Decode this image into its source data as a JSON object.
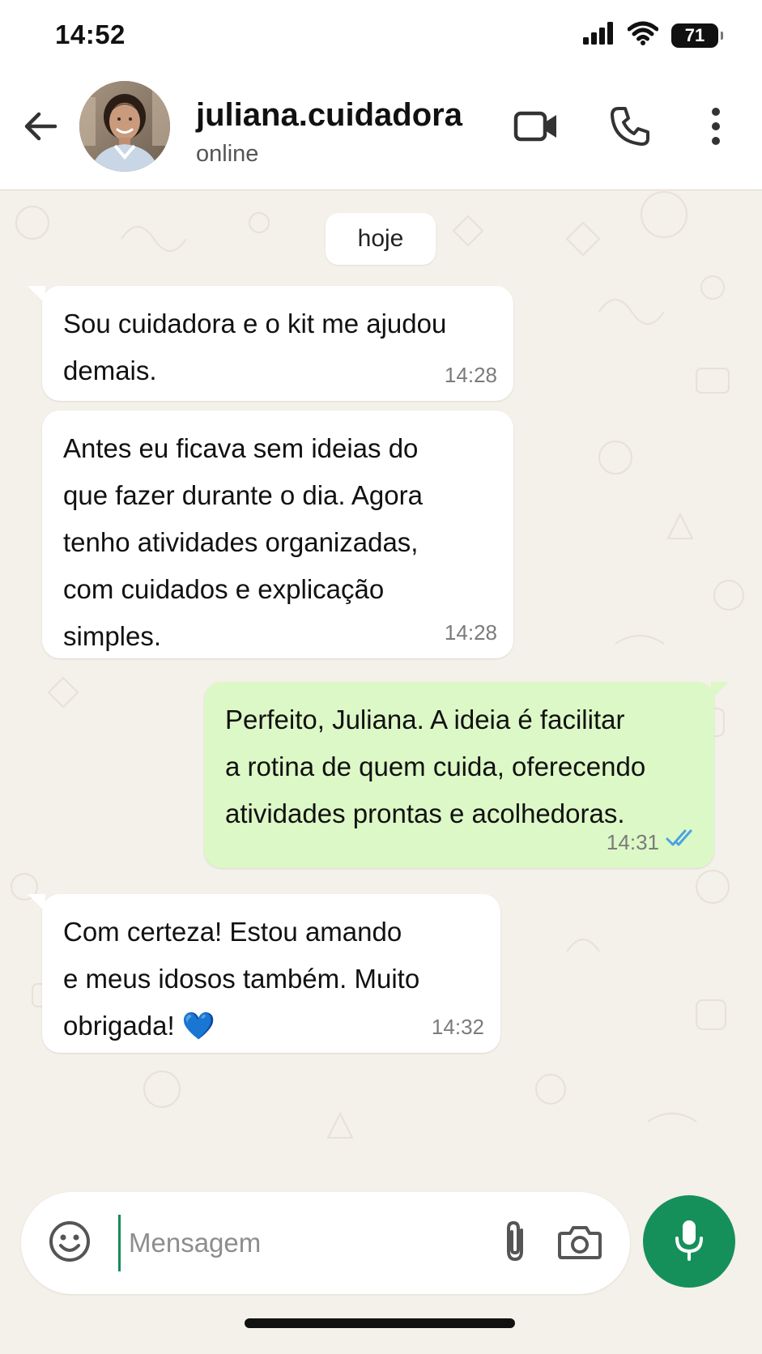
{
  "status_bar": {
    "time": "14:52",
    "battery": "71"
  },
  "header": {
    "contact_name": "juliana.cuidadora",
    "contact_status": "online",
    "icons": [
      "back-arrow-icon",
      "video-call-icon",
      "phone-icon",
      "more-vert-icon"
    ]
  },
  "chat": {
    "date_chip": "hoje",
    "messages": [
      {
        "direction": "incoming",
        "text": "Sou cuidadora e o kit me ajudou\ndemais.",
        "time": "14:28"
      },
      {
        "direction": "incoming",
        "text": "Antes eu ficava sem ideias do\nque fazer durante o dia. Agora\ntenho atividades organizadas,\ncom cuidados e explicação\nsimples.",
        "time": "14:28"
      },
      {
        "direction": "outgoing",
        "text": "Perfeito, Juliana. A ideia é facilitar\na rotina de quem cuida, oferecendo\natividades prontas e acolhedoras.",
        "time": "14:31",
        "status": "read"
      },
      {
        "direction": "incoming",
        "text": "Com certeza! Estou amando\ne meus idosos também. Muito\nobrigada! 💙",
        "time": "14:32"
      }
    ]
  },
  "composer": {
    "placeholder": "Mensagem",
    "value": "",
    "icons": [
      "emoji-icon",
      "attach-icon",
      "camera-icon",
      "mic-icon"
    ]
  },
  "colors": {
    "chat_background": "#f4f0ea",
    "outgoing_bubble": "#dcf8c6",
    "incoming_bubble": "#ffffff",
    "accent": "#16905a",
    "read_ticks": "#4aa3e0"
  }
}
